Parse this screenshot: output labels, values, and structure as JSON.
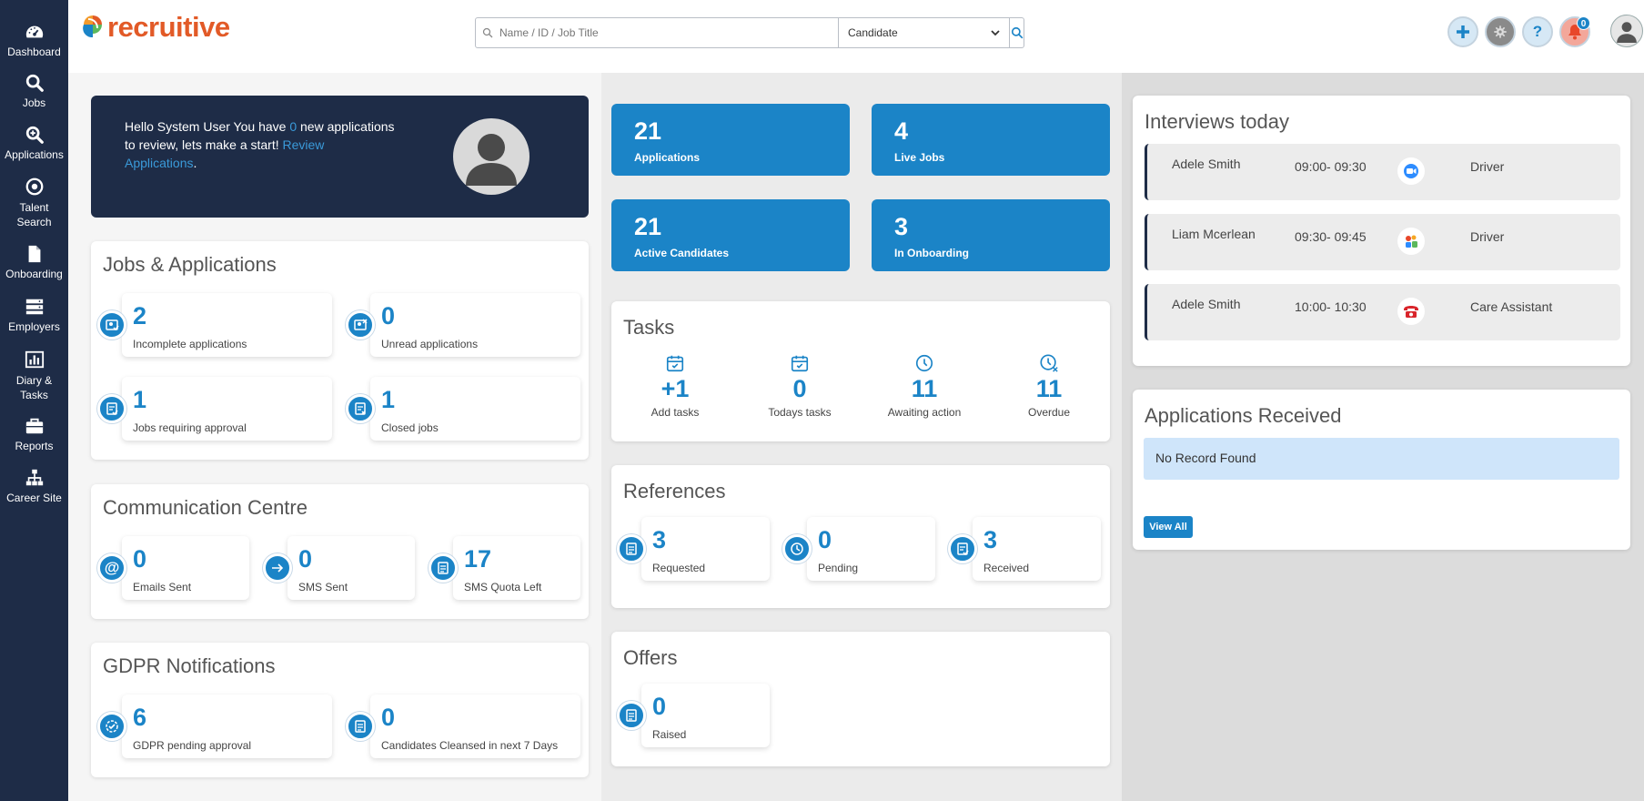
{
  "sidebar": {
    "items": [
      {
        "label": "Dashboard",
        "icon": "dashboard-icon"
      },
      {
        "label": "Jobs",
        "icon": "search-icon"
      },
      {
        "label": "Applications",
        "icon": "zoom-in-icon"
      },
      {
        "label": "Talent Search",
        "icon": "target-icon"
      },
      {
        "label": "Onboarding",
        "icon": "document-icon"
      },
      {
        "label": "Employers",
        "icon": "server-icon"
      },
      {
        "label": "Diary & Tasks",
        "icon": "bar-chart-icon"
      },
      {
        "label": "Reports",
        "icon": "briefcase-icon"
      },
      {
        "label": "Career Site",
        "icon": "sitemap-icon"
      }
    ]
  },
  "header": {
    "logo_text": "recruitive",
    "search_placeholder": "Name / ID / Job Title",
    "search_type": "Candidate",
    "notification_count": "0"
  },
  "welcome": {
    "prefix": "Hello System User You have ",
    "count": "0",
    "middle": " new applications to review, lets make a start! ",
    "link": "Review Applications",
    "suffix": "."
  },
  "jobs_applications": {
    "title": "Jobs & Applications",
    "tiles": [
      {
        "value": "2",
        "label": "Incomplete applications"
      },
      {
        "value": "0",
        "label": "Unread applications"
      },
      {
        "value": "1",
        "label": "Jobs requiring approval"
      },
      {
        "value": "1",
        "label": "Closed jobs"
      }
    ]
  },
  "communication": {
    "title": "Communication Centre",
    "tiles": [
      {
        "value": "0",
        "label": "Emails Sent",
        "icon": "at-icon"
      },
      {
        "value": "0",
        "label": "SMS Sent",
        "icon": "arrow-right-icon"
      },
      {
        "value": "17",
        "label": "SMS Quota Left",
        "icon": "document-icon"
      }
    ]
  },
  "gdpr": {
    "title": "GDPR Notifications",
    "tiles": [
      {
        "value": "6",
        "label": "GDPR pending approval"
      },
      {
        "value": "0",
        "label": "Candidates Cleansed in next 7 Days"
      }
    ]
  },
  "stats": [
    {
      "value": "21",
      "label": "Applications"
    },
    {
      "value": "4",
      "label": "Live Jobs"
    },
    {
      "value": "21",
      "label": "Active Candidates"
    },
    {
      "value": "3",
      "label": "In Onboarding"
    }
  ],
  "tasks": {
    "title": "Tasks",
    "items": [
      {
        "value": "+1",
        "label": "Add tasks"
      },
      {
        "value": "0",
        "label": "Todays tasks"
      },
      {
        "value": "11",
        "label": "Awaiting action"
      },
      {
        "value": "11",
        "label": "Overdue"
      }
    ]
  },
  "references": {
    "title": "References",
    "tiles": [
      {
        "value": "3",
        "label": "Requested"
      },
      {
        "value": "0",
        "label": "Pending"
      },
      {
        "value": "3",
        "label": "Received"
      }
    ]
  },
  "offers": {
    "title": "Offers",
    "tiles": [
      {
        "value": "0",
        "label": "Raised"
      }
    ]
  },
  "interviews": {
    "title": "Interviews today",
    "items": [
      {
        "name": "Adele Smith",
        "time": "09:00- 09:30",
        "type": "zoom-icon",
        "role": "Driver"
      },
      {
        "name": "Liam Mcerlean",
        "time": "09:30- 09:45",
        "type": "teams-icon",
        "role": "Driver"
      },
      {
        "name": "Adele Smith",
        "time": "10:00- 10:30",
        "type": "phone-icon",
        "role": "Care Assistant"
      }
    ]
  },
  "applications_received": {
    "title": "Applications Received",
    "empty_text": "No Record Found",
    "view_all": "View All"
  },
  "colors": {
    "navy": "#1e2c47",
    "accent_blue": "#1b84c7",
    "brand_orange": "#e25a27"
  }
}
